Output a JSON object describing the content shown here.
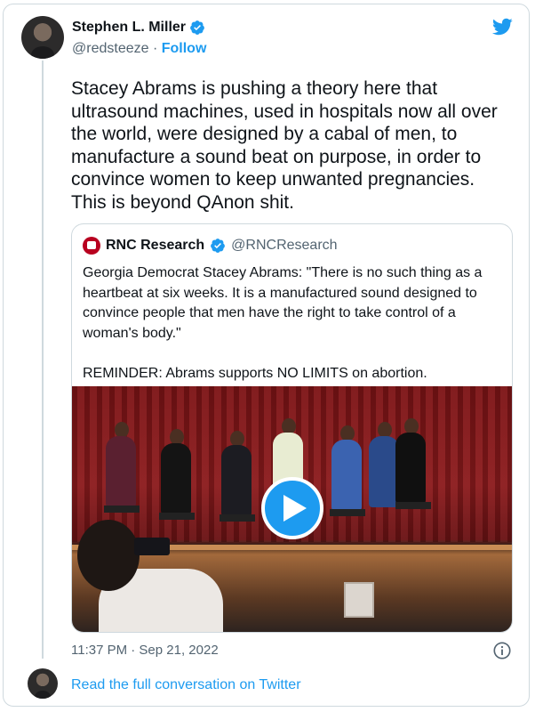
{
  "author": {
    "name": "Stephen L. Miller",
    "handle": "@redsteeze",
    "separator": " · ",
    "follow_label": "Follow"
  },
  "tweet": {
    "text": "Stacey Abrams is pushing a theory here that\nultrasound machines, used in hospitals now all over\nthe world, were designed by a cabal of men, to\nmanufacture a sound beat on purpose, in order to\nconvince women to keep unwanted pregnancies.\nThis is beyond QAnon shit.",
    "timestamp": "11:37 PM · Sep 21, 2022"
  },
  "quote": {
    "name": "RNC Research",
    "handle": "@RNCResearch",
    "text": "Georgia Democrat Stacey Abrams: \"There is no such thing as a\nheartbeat at six weeks. It is a manufactured sound designed to\nconvince people that men have the right to take control of a\nwoman's body.\"\n\nREMINDER: Abrams supports NO LIMITS on abortion."
  },
  "footer": {
    "read_full_label": "Read the full conversation on Twitter"
  },
  "icons": {
    "brand": "twitter-bird-icon",
    "verified": "verified-badge-icon",
    "play": "play-icon",
    "info": "info-icon"
  },
  "colors": {
    "accent": "#1d9bf0",
    "text": "#0f1419",
    "muted": "#536471",
    "border": "#cfd9de"
  }
}
